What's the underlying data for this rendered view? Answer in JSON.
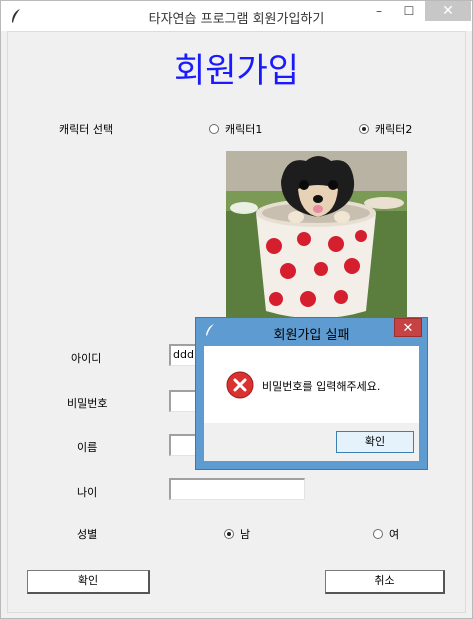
{
  "window": {
    "title": "타자연습 프로그램 회원가입하기",
    "controls": {
      "minimize": "–",
      "maximize": "☐",
      "close": "✕"
    }
  },
  "heading": "회원가입",
  "character": {
    "label": "캐릭터 선택",
    "options": [
      {
        "label": "캐릭터1",
        "selected": false
      },
      {
        "label": "캐릭터2",
        "selected": true
      }
    ],
    "image_description": "puppy in a polka-dot cup"
  },
  "form": {
    "id_label": "아이디",
    "id_value": "ddd",
    "password_label": "비밀번호",
    "password_value": "",
    "name_label": "이름",
    "name_value": "",
    "age_label": "나이",
    "age_value": "",
    "gender_label": "성별",
    "gender_options": [
      {
        "label": "남",
        "selected": true
      },
      {
        "label": "여",
        "selected": false
      }
    ]
  },
  "buttons": {
    "confirm": "확인",
    "cancel": "취소"
  },
  "dialog": {
    "title": "회원가입 실패",
    "close": "✕",
    "message": "비밀번호를 입력해주세요.",
    "ok": "확인",
    "icon": "error-icon"
  },
  "colors": {
    "heading": "#1a1aff",
    "dialog_frame": "#5e9bd0",
    "dialog_close": "#c74242"
  }
}
